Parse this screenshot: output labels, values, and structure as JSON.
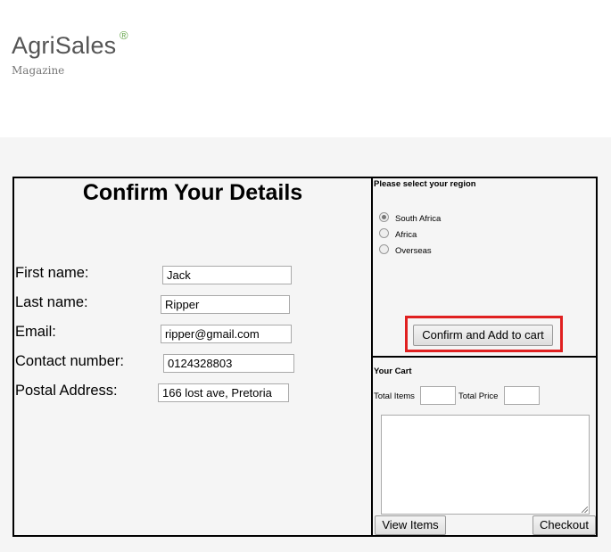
{
  "brand": {
    "name": "AgriSales",
    "registered_mark": "®",
    "tagline": "Magazine"
  },
  "details": {
    "title": "Confirm Your Details",
    "fields": {
      "first_name": {
        "label": "First name:",
        "value": "Jack"
      },
      "last_name": {
        "label": "Last name:",
        "value": "Ripper"
      },
      "email": {
        "label": "Email:",
        "value": "ripper@gmail.com"
      },
      "contact": {
        "label": "Contact number:",
        "value": "0124328803"
      },
      "address": {
        "label": "Postal Address:",
        "value": "166 lost ave, Pretoria"
      }
    }
  },
  "region": {
    "title": "Please select your region",
    "options": [
      {
        "label": "South Africa",
        "checked": true
      },
      {
        "label": "Africa",
        "checked": false
      },
      {
        "label": "Overseas",
        "checked": false
      }
    ],
    "confirm_label": "Confirm and Add to cart",
    "highlight_color": "#e02020"
  },
  "cart": {
    "title": "Your Cart",
    "total_items_label": "Total Items",
    "total_price_label": "Total Price",
    "total_items_value": "",
    "total_price_value": "",
    "view_items_label": "View Items",
    "checkout_label": "Checkout"
  }
}
